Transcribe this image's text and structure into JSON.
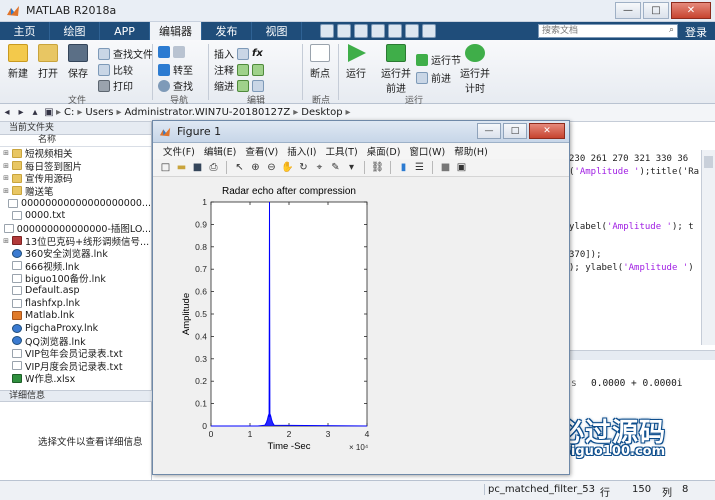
{
  "app": {
    "title": "MATLAB R2018a",
    "window_buttons": [
      "—",
      "□",
      "✕"
    ]
  },
  "ribbon_tabs": [
    "主页",
    "绘图",
    "APP",
    "编辑器",
    "发布",
    "视图"
  ],
  "search": {
    "placeholder": "搜索文档"
  },
  "login_label": "登录",
  "ribbon": {
    "new_label": "新建",
    "open_label": "打开",
    "save_label": "保存",
    "find_files_label": "查找文件",
    "compare_label": "比较",
    "print_label": "打印",
    "goto_label": "转至",
    "find_label": "查找",
    "insert_label": "插入",
    "comment_label": "注释",
    "indent_label": "缩进",
    "fx_label": "fx",
    "breakpoint_label": "断点",
    "run_label": "运行",
    "run_advance_label": "运行并前进",
    "run_section_label": "运行节",
    "advance_label": "前进",
    "run_time_label": "运行并计时",
    "group_file": "文件",
    "group_nav": "导航",
    "group_edit": "编辑",
    "group_breakpoint": "断点",
    "group_run": "运行"
  },
  "address": [
    "C:",
    "Users",
    "Administrator.WIN7U-20180127Z",
    "Desktop"
  ],
  "left_panel": {
    "title": "当前文件夹",
    "column_header": "名称",
    "files": [
      {
        "name": "短视频相关",
        "type": "folder",
        "expand": "⊞"
      },
      {
        "name": "每日签到图片",
        "type": "folder",
        "expand": "⊞"
      },
      {
        "name": "宣传用源码",
        "type": "folder",
        "expand": "⊞"
      },
      {
        "name": "赠送笔",
        "type": "folder",
        "expand": "⊞"
      },
      {
        "name": "00000000000000000000...",
        "type": "file",
        "expand": ""
      },
      {
        "name": "0000.txt",
        "type": "file",
        "expand": ""
      },
      {
        "name": "000000000000000-插图LO...",
        "type": "file",
        "expand": ""
      },
      {
        "name": "13位巴克码+线形调频信号...",
        "type": "zip",
        "expand": "⊞"
      },
      {
        "name": "360安全浏览器.lnk",
        "type": "app",
        "expand": ""
      },
      {
        "name": "666视频.lnk",
        "type": "file",
        "expand": ""
      },
      {
        "name": "biguo100备份.lnk",
        "type": "file",
        "expand": ""
      },
      {
        "name": "Default.asp",
        "type": "file",
        "expand": ""
      },
      {
        "name": "flashfxp.lnk",
        "type": "file",
        "expand": ""
      },
      {
        "name": "Matlab.lnk",
        "type": "m",
        "expand": ""
      },
      {
        "name": "PigchaProxy.lnk",
        "type": "app",
        "expand": ""
      },
      {
        "name": "QQ浏览器.lnk",
        "type": "app",
        "expand": ""
      },
      {
        "name": "VIP包年会员记录表.txt",
        "type": "file",
        "expand": ""
      },
      {
        "name": "VIP月度会员记录表.txt",
        "type": "file",
        "expand": ""
      },
      {
        "name": "W作息.xlsx",
        "type": "xls",
        "expand": ""
      }
    ],
    "details_title": "详细信息",
    "details_text": "选择文件以查看详细信息"
  },
  "editor": {
    "lines": [
      {
        "pre": "230 261 270 321 330 36",
        "str": "",
        "post": ""
      },
      {
        "pre": "(",
        "str": "'Amplitude '",
        "post": ");title('Ra"
      },
      {
        "pre": "ylabel(",
        "str": "'Amplitude '",
        "post": "); t"
      },
      {
        "pre": "370]);",
        "str": "",
        "post": ""
      },
      {
        "pre": "); ylabel(",
        "str": "'Amplitude '",
        "post": ")"
      }
    ]
  },
  "command_window": {
    "marker": "s",
    "complex_value": "0.0000 + 0.0000i"
  },
  "watermark": {
    "title": "必过源码",
    "url": "Biguo100.com"
  },
  "status": {
    "file": "pc_matched_filter_53",
    "row_label": "行",
    "row_value": "150",
    "col_label": "列",
    "col_value": "8"
  },
  "figure": {
    "title": "Figure 1",
    "menus": [
      "文件(F)",
      "编辑(E)",
      "查看(V)",
      "插入(I)",
      "工具(T)",
      "桌面(D)",
      "窗口(W)",
      "帮助(H)"
    ]
  },
  "chart_data": {
    "type": "line",
    "title": "Radar echo after compression",
    "xlabel": "Time -Sec",
    "ylabel": "Amplitude",
    "x_exponent_label": "× 10⁴",
    "xlim": [
      0,
      4
    ],
    "ylim": [
      0,
      1
    ],
    "xticks": [
      0,
      1,
      2,
      3,
      4
    ],
    "yticks": [
      0,
      0.1,
      0.2,
      0.3,
      0.4,
      0.5,
      0.6,
      0.7,
      0.8,
      0.9,
      1
    ],
    "color": "#0000ff",
    "grid": false,
    "series": [
      {
        "x": [
          0,
          1.2,
          1.38,
          1.42,
          1.45,
          1.47,
          1.48,
          1.49,
          1.5,
          1.51,
          1.52,
          1.53,
          1.55,
          1.58,
          1.62,
          4
        ],
        "y": [
          0,
          0,
          0.003,
          0.015,
          0.03,
          0.045,
          0.05,
          0.04,
          1.0,
          0.04,
          0.05,
          0.045,
          0.03,
          0.015,
          0.003,
          0
        ]
      }
    ]
  }
}
